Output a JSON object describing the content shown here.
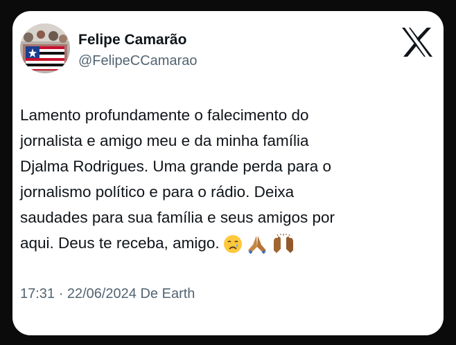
{
  "author": {
    "name": "Felipe Camarão",
    "handle": "@FelipeCCamarao",
    "avatar_icon": "avatar-with-maranhao-flag"
  },
  "brand": {
    "logo_icon": "x-logo-icon",
    "color": "#0f1419"
  },
  "tweet": {
    "lines": [
      "Lamento profundamente o falecimento do",
      "jornalista e amigo meu e da minha família",
      "Djalma Rodrigues. Uma grande perda para o",
      "jornalismo político e para o rádio. Deixa",
      "saudades para sua família e seus amigos por",
      "aqui. Deus te receba, amigo."
    ],
    "emojis": [
      "crying-face-emoji",
      "folded-hands-emoji",
      "raising-hands-emoji"
    ]
  },
  "meta": {
    "timestamp": "17:31 · 22/06/2024 De Earth"
  },
  "colors": {
    "background": "#0b0b0b",
    "card": "#ffffff",
    "text": "#0f1419",
    "secondary_text": "#536471"
  }
}
